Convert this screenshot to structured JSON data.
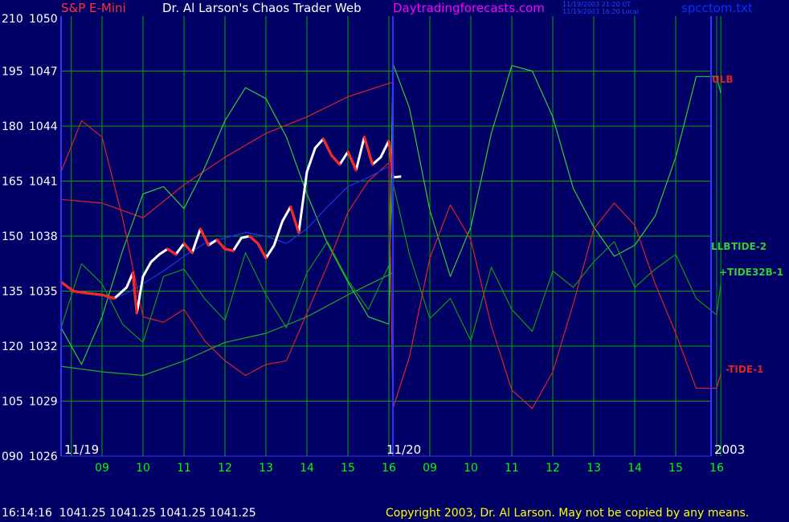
{
  "header": {
    "instrument": "S&P E-Mini",
    "title": "Dr. Al Larson's Chaos Trader Web",
    "site": "Daytradingforecasts.com",
    "utc_time": "11/19/2003 21:20 UT",
    "local_time": "11/19/2003 16:20 Local",
    "file": "spcctom.txt"
  },
  "footer": {
    "quote": "16:14:16  1041.25 1041.25 1041.25 1041.25",
    "copyright": "Copyright 2003, Dr. Al Larson. May not be copied by any means."
  },
  "colors": {
    "background": "#000066",
    "grid": "#00aa00",
    "axis": "#3333ff",
    "price_up": "#ffffff",
    "price_down": "#ff2020",
    "ulb": "#dd2222",
    "llb": "#22aa22",
    "tide2": "#33cc33",
    "tide32b1": "#119911",
    "tide1": "#dd2222",
    "moving_avg": "#2233dd",
    "title_red": "#ff3333",
    "title_white": "#ffffff",
    "site_magenta": "#ff00ff",
    "file_blue": "#0033ff",
    "time_label": "#00ff00",
    "copyright_yellow": "#ffff00"
  },
  "chart_data": {
    "type": "line",
    "y_left_index": [
      "210",
      "195",
      "180",
      "165",
      "150",
      "135",
      "120",
      "105",
      "090"
    ],
    "y_price": [
      "1050",
      "1047",
      "1044",
      "1041",
      "1038",
      "1035",
      "1032",
      "1029",
      "1026"
    ],
    "ylim": [
      1026,
      1050
    ],
    "x_hours": [
      "09",
      "10",
      "11",
      "12",
      "13",
      "14",
      "15",
      "16",
      "09",
      "10",
      "11",
      "12",
      "13",
      "14",
      "15",
      "16"
    ],
    "date_labels": [
      "11/19",
      "11/20",
      "2003"
    ],
    "hour_grid": [
      8.25,
      9,
      10,
      11,
      12,
      13,
      14,
      15,
      16,
      17,
      18,
      19,
      20,
      21,
      22,
      23,
      24,
      24.1
    ],
    "today_end": 16.1,
    "series": [
      {
        "name": "ULB",
        "label": "ULB",
        "color_key": "ulb",
        "x": [
          8.0,
          9.0,
          10.0,
          11.0,
          12.0,
          13.0,
          14.0,
          15.0,
          16.1
        ],
        "y": [
          1040.0,
          1039.8,
          1039.0,
          1040.8,
          1042.3,
          1043.6,
          1044.5,
          1045.6,
          1046.4
        ]
      },
      {
        "name": "LLB",
        "label": "LLB",
        "color_key": "llb",
        "x": [
          8.0,
          9.0,
          10.0,
          11.0,
          12.0,
          13.0,
          14.0,
          15.0,
          16.1
        ],
        "y": [
          1030.9,
          1030.6,
          1030.4,
          1031.2,
          1032.2,
          1032.7,
          1033.6,
          1034.8,
          1036.0
        ]
      },
      {
        "name": "TIDE-2",
        "label": "TIDE-2",
        "color_key": "tide2",
        "x": [
          8.0,
          8.5,
          9.0,
          9.5,
          10.0,
          10.5,
          11.0,
          11.5,
          12.0,
          12.5,
          13.0,
          13.5,
          14.0,
          14.5,
          15.0,
          15.5,
          16.0,
          16.1,
          16.5,
          17.0,
          17.5,
          18.0,
          18.5,
          19.0,
          19.5,
          20.0,
          20.5,
          21.0,
          21.5,
          22.0,
          22.5,
          23.0,
          23.5,
          24.0,
          24.1
        ],
        "y": [
          1033.0,
          1031.0,
          1033.6,
          1037.2,
          1040.3,
          1040.7,
          1039.5,
          1041.7,
          1044.3,
          1046.1,
          1045.5,
          1043.4,
          1040.3,
          1037.6,
          1035.5,
          1033.6,
          1033.2,
          1047.4,
          1045.0,
          1039.4,
          1035.8,
          1038.5,
          1043.6,
          1047.3,
          1047.0,
          1044.5,
          1040.6,
          1038.5,
          1036.9,
          1037.5,
          1039.1,
          1042.3,
          1046.7,
          1046.7,
          1045.8
        ]
      },
      {
        "name": "TIDE32B-1",
        "label": "+TIDE32B-1",
        "color_key": "tide32b1",
        "x": [
          8.0,
          8.5,
          9.0,
          9.5,
          10.0,
          10.5,
          11.0,
          11.5,
          12.0,
          12.5,
          13.0,
          13.5,
          14.0,
          14.5,
          15.0,
          15.5,
          16.0,
          16.1,
          16.5,
          17.0,
          17.5,
          18.0,
          18.5,
          19.0,
          19.5,
          20.0,
          20.5,
          21.0,
          21.5,
          22.0,
          22.5,
          23.0,
          23.5,
          24.0,
          24.1
        ],
        "y": [
          1033.0,
          1036.5,
          1035.4,
          1033.2,
          1032.2,
          1035.8,
          1036.2,
          1034.6,
          1033.4,
          1037.1,
          1034.8,
          1033.0,
          1036.0,
          1037.7,
          1035.6,
          1034.0,
          1036.4,
          1040.9,
          1037.0,
          1033.5,
          1034.6,
          1032.3,
          1036.3,
          1034.0,
          1032.8,
          1036.1,
          1035.2,
          1036.6,
          1037.7,
          1035.2,
          1036.2,
          1037.0,
          1034.6,
          1033.7,
          1035.4
        ]
      },
      {
        "name": "TIDE-1",
        "label": "-TIDE-1",
        "color_key": "tide1",
        "x": [
          8.0,
          8.5,
          9.0,
          9.5,
          10.0,
          10.5,
          11.0,
          11.5,
          12.0,
          12.5,
          13.0,
          13.5,
          14.0,
          14.5,
          15.0,
          15.5,
          16.0,
          16.1,
          16.5,
          17.0,
          17.5,
          18.0,
          18.5,
          19.0,
          19.5,
          20.0,
          20.5,
          21.0,
          21.5,
          22.0,
          22.5,
          23.0,
          23.5,
          24.0,
          24.1
        ],
        "y": [
          1041.5,
          1044.3,
          1043.4,
          1039.0,
          1033.6,
          1033.3,
          1034.0,
          1032.3,
          1031.2,
          1030.4,
          1031.0,
          1031.2,
          1033.8,
          1036.4,
          1039.3,
          1041.0,
          1042.0,
          1028.6,
          1031.4,
          1036.8,
          1039.7,
          1037.8,
          1033.1,
          1029.6,
          1028.6,
          1030.6,
          1034.3,
          1038.4,
          1039.8,
          1038.6,
          1035.4,
          1032.7,
          1029.7,
          1029.7,
          1030.5
        ]
      },
      {
        "name": "Moving average",
        "color_key": "moving_avg",
        "x": [
          9.2,
          9.7,
          10.0,
          10.5,
          11.0,
          11.5,
          12.0,
          12.5,
          13.0,
          13.5,
          14.0,
          14.5,
          15.0,
          15.5,
          16.0
        ],
        "y": [
          1034.5,
          1035.0,
          1035.4,
          1036.1,
          1036.9,
          1037.6,
          1037.9,
          1038.2,
          1038.0,
          1037.6,
          1038.4,
          1039.6,
          1040.7,
          1041.2,
          1041.8
        ]
      },
      {
        "name": "S&P E-Mini price",
        "color_key": "price_up",
        "x": [
          8.0,
          8.3,
          8.6,
          9.0,
          9.3,
          9.6,
          9.75,
          9.85,
          10.0,
          10.2,
          10.4,
          10.6,
          10.8,
          11.0,
          11.2,
          11.4,
          11.6,
          11.8,
          12.0,
          12.2,
          12.4,
          12.6,
          12.8,
          13.0,
          13.2,
          13.4,
          13.6,
          13.8,
          14.0,
          14.2,
          14.4,
          14.6,
          14.8,
          15.0,
          15.2,
          15.4,
          15.6,
          15.8,
          16.0,
          16.1,
          16.3
        ],
        "y": [
          1035.5,
          1035.0,
          1034.9,
          1034.8,
          1034.6,
          1035.2,
          1036.0,
          1033.8,
          1035.8,
          1036.6,
          1037.0,
          1037.3,
          1037.0,
          1037.6,
          1037.1,
          1038.4,
          1037.5,
          1037.8,
          1037.3,
          1037.2,
          1037.9,
          1038.0,
          1037.6,
          1036.8,
          1037.5,
          1038.8,
          1039.6,
          1038.2,
          1041.5,
          1042.8,
          1043.3,
          1042.4,
          1041.9,
          1042.6,
          1041.6,
          1043.4,
          1041.9,
          1042.3,
          1043.2,
          1041.2,
          1041.25
        ]
      }
    ]
  }
}
